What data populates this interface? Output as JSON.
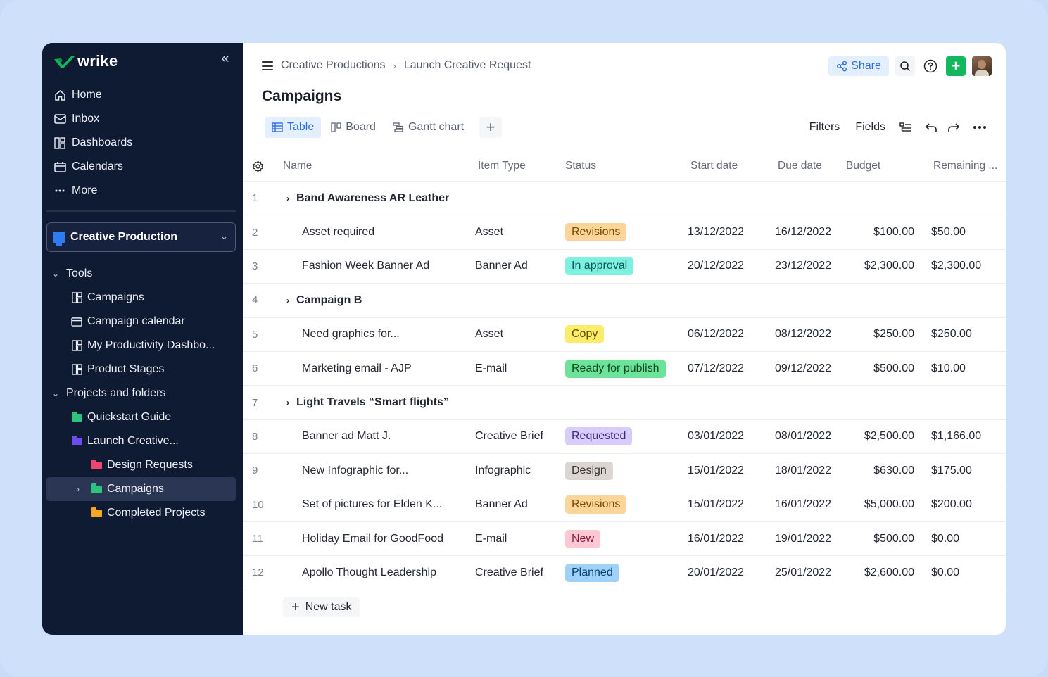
{
  "app": {
    "logo_text": "wrike",
    "brand_color": "#14b85c"
  },
  "sidebar": {
    "nav": [
      {
        "label": "Home",
        "icon": "home-icon"
      },
      {
        "label": "Inbox",
        "icon": "inbox-icon"
      },
      {
        "label": "Dashboards",
        "icon": "dashboard-icon"
      },
      {
        "label": "Calendars",
        "icon": "calendar-icon"
      },
      {
        "label": "More",
        "icon": "more-icon"
      }
    ],
    "space": {
      "label": "Creative Production"
    },
    "tree": [
      {
        "label": "Tools",
        "kind": "section"
      },
      {
        "label": "Campaigns",
        "kind": "dashboard"
      },
      {
        "label": "Campaign calendar",
        "kind": "calendar"
      },
      {
        "label": "My Productivity Dashbo...",
        "kind": "dashboard"
      },
      {
        "label": "Product Stages",
        "kind": "dashboard"
      },
      {
        "label": "Projects and folders",
        "kind": "section"
      },
      {
        "label": "Quickstart Guide",
        "kind": "folder",
        "color": "#2ec27e"
      },
      {
        "label": "Launch Creative...",
        "kind": "folder",
        "color": "#6c4ef0"
      },
      {
        "label": "Design Requests",
        "kind": "folder",
        "color": "#f0456e"
      },
      {
        "label": "Campaigns",
        "kind": "folder",
        "color": "#2ec27e",
        "selected": true
      },
      {
        "label": "Completed Projects",
        "kind": "folder",
        "color": "#f5a623"
      }
    ]
  },
  "header": {
    "breadcrumb": [
      "Creative Productions",
      "Launch Creative Request"
    ],
    "share_label": "Share",
    "title": "Campaigns"
  },
  "views": {
    "tabs": [
      {
        "label": "Table",
        "active": true
      },
      {
        "label": "Board",
        "active": false
      },
      {
        "label": "Gantt chart",
        "active": false
      }
    ],
    "filters_label": "Filters",
    "fields_label": "Fields"
  },
  "table": {
    "columns": [
      "Name",
      "Item Type",
      "Status",
      "Start date",
      "Due date",
      "Budget",
      "Remaining ..."
    ],
    "rows": [
      {
        "num": "1",
        "group": true,
        "name": "Band Awareness AR Leather"
      },
      {
        "num": "2",
        "name": "Asset required",
        "type": "Asset",
        "status": "Revisions",
        "status_bg": "#fcd59a",
        "status_fg": "#7a4b00",
        "start": "13/12/2022",
        "due": "16/12/2022",
        "budget": "$100.00",
        "remaining": "$50.00"
      },
      {
        "num": "3",
        "name": "Fashion Week Banner Ad",
        "type": "Banner Ad",
        "status": "In approval",
        "status_bg": "#7ff0e0",
        "status_fg": "#0b5a52",
        "start": "20/12/2022",
        "due": "23/12/2022",
        "budget": "$2,300.00",
        "remaining": "$2,300.00"
      },
      {
        "num": "4",
        "group": true,
        "name": "Campaign B"
      },
      {
        "num": "5",
        "name": "Need graphics for...",
        "type": "Asset",
        "status": "Copy",
        "status_bg": "#fbec6b",
        "status_fg": "#5c4d00",
        "start": "06/12/2022",
        "due": "08/12/2022",
        "budget": "$250.00",
        "remaining": "$250.00"
      },
      {
        "num": "6",
        "name": "Marketing email - AJP",
        "type": "E-mail",
        "status": "Ready for publish",
        "status_bg": "#6de39a",
        "status_fg": "#0c4a24",
        "start": "07/12/2022",
        "due": "09/12/2022",
        "budget": "$500.00",
        "remaining": "$10.00"
      },
      {
        "num": "7",
        "group": true,
        "name": "Light Travels “Smart flights”"
      },
      {
        "num": "8",
        "name": "Banner ad Matt J.",
        "type": "Creative Brief",
        "status": "Requested",
        "status_bg": "#d8ccfb",
        "status_fg": "#3f2a8a",
        "start": "03/01/2022",
        "due": "08/01/2022",
        "budget": "$2,500.00",
        "remaining": "$1,166.00"
      },
      {
        "num": "9",
        "name": "New Infographic for...",
        "type": "Infographic",
        "status": "Design",
        "status_bg": "#dcd6d3",
        "status_fg": "#3a3330",
        "start": "15/01/2022",
        "due": "18/01/2022",
        "budget": "$630.00",
        "remaining": "$175.00"
      },
      {
        "num": "10",
        "name": "Set of pictures for Elden K...",
        "type": "Banner Ad",
        "status": "Revisions",
        "status_bg": "#fcd59a",
        "status_fg": "#7a4b00",
        "start": "15/01/2022",
        "due": "16/01/2022",
        "budget": "$5,000.00",
        "remaining": "$200.00"
      },
      {
        "num": "11",
        "name": "Holiday Email for GoodFood",
        "type": "E-mail",
        "status": "New",
        "status_bg": "#fdc8d3",
        "status_fg": "#8a1c38",
        "start": "16/01/2022",
        "due": "19/01/2022",
        "budget": "$500.00",
        "remaining": "$0.00"
      },
      {
        "num": "12",
        "name": "Apollo Thought Leadership",
        "type": "Creative Brief",
        "status": "Planned",
        "status_bg": "#9fd2fb",
        "status_fg": "#0b3d6b",
        "start": "20/01/2022",
        "due": "25/01/2022",
        "budget": "$2,600.00",
        "remaining": "$0.00"
      }
    ],
    "new_task_label": "New task"
  }
}
